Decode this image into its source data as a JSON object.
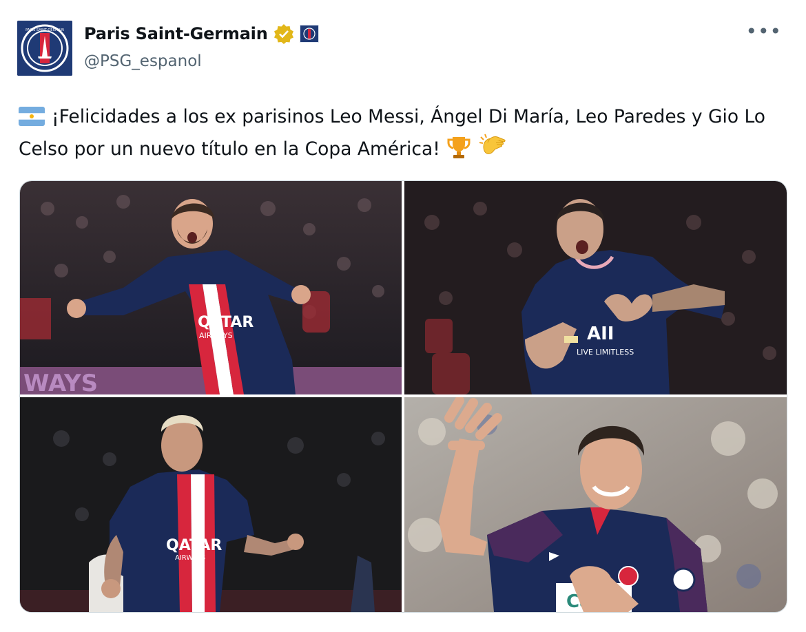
{
  "tweet": {
    "display_name": "Paris Saint-Germain",
    "handle": "@PSG_espanol",
    "verified_badge": "gold-verified-badge",
    "affiliate_badge": "psg-affiliate-badge",
    "more_label": "•••",
    "text": "¡Felicidades a los ex parisinos Leo Messi, Ángel Di María, Leo Paredes y Gio Lo Celso por un nuevo título en la Copa América!",
    "leading_emoji": "argentina-flag",
    "trailing_emojis": [
      "trophy",
      "clapping-hands"
    ]
  },
  "avatar": {
    "label": "PARIS SAINT-GERMAIN",
    "colors": {
      "navy": "#1f3a75",
      "red": "#d7263d",
      "white": "#ffffff"
    }
  },
  "media": {
    "photos": [
      {
        "player": "Leo Messi",
        "shirt_text": "QATAR",
        "shirt_subtext": "AIRWAYS",
        "board_text": "WAYS"
      },
      {
        "player": "Ángel Di María",
        "shirt_text": "AII",
        "shirt_subtext": "LIVE LIMITLESS"
      },
      {
        "player": "Leo Paredes",
        "shirt_text": "QATAR",
        "shirt_subtext": "AIRWAYS"
      },
      {
        "player": "Gio Lo Celso",
        "shirt_text": "Ca"
      }
    ]
  },
  "colors": {
    "text": "#0f1419",
    "muted": "#536471",
    "border": "#cfd9de",
    "verified": "#e2b719",
    "psg_navy": "#1b2a58",
    "psg_red": "#d7263d"
  }
}
